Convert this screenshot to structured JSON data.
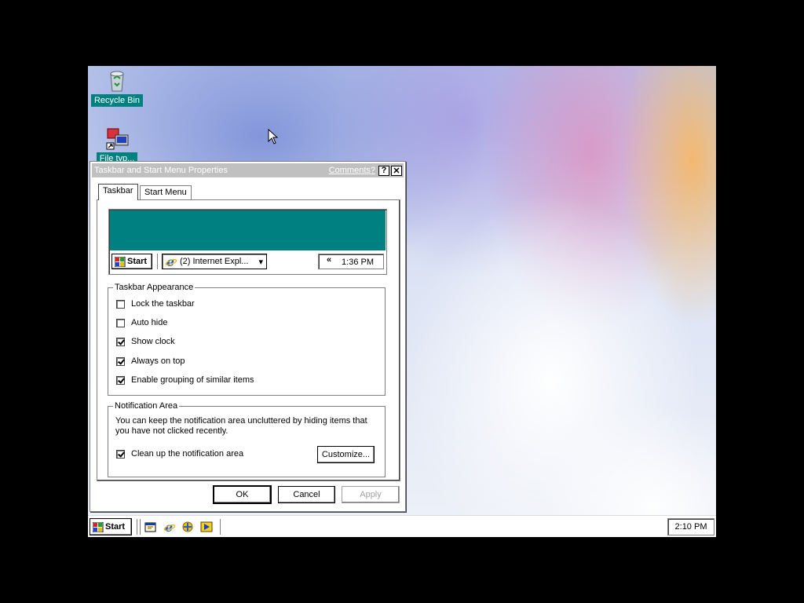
{
  "desktop": {
    "icons": [
      {
        "label": "Recycle Bin"
      },
      {
        "label": "File typ..."
      }
    ]
  },
  "dialog": {
    "title": "Taskbar and Start Menu Properties",
    "comments_link": "Comments?",
    "help_button": "?",
    "close_button": "✕",
    "tabs": [
      {
        "label": "Taskbar",
        "active": true
      },
      {
        "label": "Start Menu",
        "active": false
      }
    ],
    "preview": {
      "start_label": "Start",
      "task_label": "(2) Internet Expl...",
      "task_arrow": "▾",
      "tray_chevron": "«",
      "clock": "1:36 PM"
    },
    "appearance": {
      "legend": "Taskbar Appearance",
      "options": [
        {
          "label": "Lock the taskbar",
          "checked": false
        },
        {
          "label": "Auto hide",
          "checked": false
        },
        {
          "label": "Show clock",
          "checked": true
        },
        {
          "label": "Always on top",
          "checked": true
        },
        {
          "label": "Enable grouping of similar items",
          "checked": true
        }
      ]
    },
    "notification": {
      "legend": "Notification Area",
      "description": "You can keep the notification area uncluttered by hiding items that you have not clicked recently.",
      "cleanup_label": "Clean up the notification area",
      "cleanup_checked": true,
      "customize_button": "Customize..."
    },
    "buttons": {
      "ok": "OK",
      "cancel": "Cancel",
      "apply": "Apply"
    }
  },
  "taskbar": {
    "start_label": "Start",
    "quick_launch": [
      "show-desktop-icon",
      "internet-explorer-icon",
      "channels-icon",
      "media-player-icon"
    ],
    "clock": "2:10 PM"
  },
  "colors": {
    "teal": "#008080",
    "ie_blue": "#1b5fcf"
  }
}
